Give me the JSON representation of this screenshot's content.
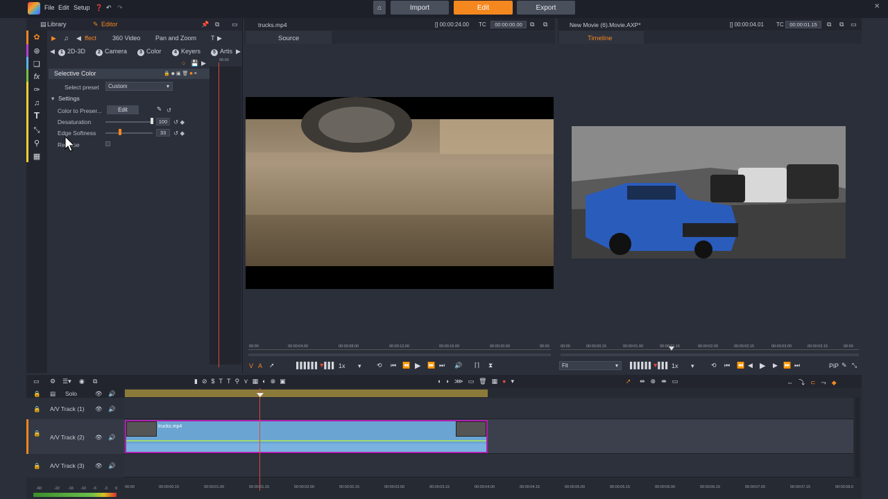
{
  "menu": {
    "file": "File",
    "edit": "Edit",
    "setup": "Setup"
  },
  "nav": {
    "import": "Import",
    "edit": "Edit",
    "export": "Export"
  },
  "left": {
    "library": "Library",
    "editor": "Editor",
    "top_tabs": [
      "ffect",
      "360 Video",
      "Pan and Zoom",
      "T"
    ],
    "sub_tabs": [
      {
        "n": "1",
        "label": "2D-3D"
      },
      {
        "n": "2",
        "label": "Camera"
      },
      {
        "n": "3",
        "label": "Color"
      },
      {
        "n": "4",
        "label": "Keyers"
      },
      {
        "n": "5",
        "label": "Artis"
      }
    ],
    "effect_title": "Selective Color",
    "select_preset_label": "Select preset",
    "select_preset_value": "Custom",
    "settings_label": "Settings",
    "color_to_preserve": "Color to Preser...",
    "edit_btn": "Edit",
    "desaturation": "Desaturation",
    "desaturation_val": "100",
    "edge_softness": "Edge Softness",
    "edge_val": "33",
    "reverse": "Reverse",
    "ruler_start": "00:00"
  },
  "source": {
    "file": "trucks.mp4",
    "duration": "[] 00:00:24.00",
    "tc_label": "TC",
    "tc_val": "00:00:00.00",
    "tab": "Source",
    "ruler": [
      "00:00",
      "00:00:04.00",
      "00:00:08.00",
      "00:00:12.00",
      "00:00:16.00",
      "00:00:20.00",
      "00:00"
    ],
    "va_v": "V",
    "va_a": "A",
    "speed": "1x"
  },
  "timeline": {
    "file": "New Movie (6).Movie.AXP*",
    "duration": "[] 00:00:04.01",
    "tc_label": "TC",
    "tc_val": "00:00:01.15",
    "tab": "Timeline",
    "ruler": [
      "00:00",
      "00:00:00.15",
      "00:00:01.00",
      "00:00:01.15",
      "00:00:02.00",
      "00:00:02.15",
      "00:00:03.00",
      "00:00:03.15",
      "00:00"
    ],
    "fit": "Fit",
    "speed": "1x",
    "pip": "PiP"
  },
  "tracks": {
    "solo": "Solo",
    "t1": "A/V Track (1)",
    "t2": "A/V Track (2)",
    "t3": "A/V Track (3)",
    "clip_name": "trucks.mp4"
  },
  "bottom_ruler": [
    "00:00",
    "00:00:00.15",
    "00:00:01.00",
    "00:00:01.15",
    "00:00:02.00",
    "00:00:02.15",
    "00:00:03.00",
    "00:00:03.15",
    "00:00:04.00",
    "00:00:04.15",
    "00:00:05.00",
    "00:00:05.15",
    "00:00:06.00",
    "00:00:06.15",
    "00:00:07.00",
    "00:00:07.15",
    "00:00:08.0"
  ],
  "meter": [
    "-60",
    "-22",
    "-16",
    "-10",
    "-6",
    "-3",
    "0"
  ]
}
